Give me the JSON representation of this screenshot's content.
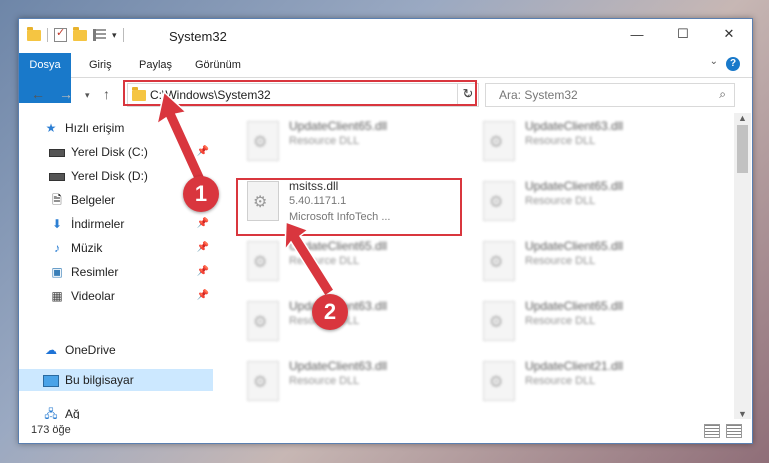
{
  "window": {
    "title": "System32"
  },
  "controls": {
    "minimize": "—",
    "maximize": "☐",
    "close": "✕"
  },
  "ribbon": {
    "tabs": [
      "Dosya",
      "Giriş",
      "Paylaş",
      "Görünüm"
    ],
    "help": "?"
  },
  "address": {
    "path": "C:\\Windows\\System32"
  },
  "search": {
    "placeholder": "Ara: System32"
  },
  "nav": {
    "items": [
      {
        "label": "Hızlı erişim",
        "icon": "star-icon"
      },
      {
        "label": "Yerel Disk (C:)",
        "icon": "disk-icon"
      },
      {
        "label": "Yerel Disk (D:)",
        "icon": "disk-icon"
      },
      {
        "label": "Belgeler",
        "icon": "documents-icon"
      },
      {
        "label": "İndirmeler",
        "icon": "download-icon"
      },
      {
        "label": "Müzik",
        "icon": "music-icon"
      },
      {
        "label": "Resimler",
        "icon": "pictures-icon"
      },
      {
        "label": "Videolar",
        "icon": "videos-icon"
      },
      {
        "label": "OneDrive",
        "icon": "cloud-icon"
      },
      {
        "label": "Bu bilgisayar",
        "icon": "computer-icon"
      },
      {
        "label": "Ağ",
        "icon": "network-icon"
      }
    ]
  },
  "files": {
    "highlighted": {
      "name": "msitss.dll",
      "version": "5.40.1171.1",
      "description": "Microsoft InfoTech ..."
    },
    "others": [
      {
        "name": "UpdateClient65.dll",
        "type": "Resource DLL"
      },
      {
        "name": "UpdateClient63.dll",
        "type": "Resource DLL"
      },
      {
        "name": "UpdateClient65.dll",
        "type": "Resource DLL"
      },
      {
        "name": "UpdateClient65.dll",
        "type": "Resource DLL"
      },
      {
        "name": "UpdateClient65.dll",
        "type": "Resource DLL"
      },
      {
        "name": "UpdateClient63.dll",
        "type": "Resource DLL"
      },
      {
        "name": "UpdateClient65.dll",
        "type": "Resource DLL"
      },
      {
        "name": "UpdateClient63.dll",
        "type": "Resource DLL"
      },
      {
        "name": "UpdateClient63.dll",
        "type": "Resource DLL"
      },
      {
        "name": "UpdateClient21.dll",
        "type": "Resource DLL"
      }
    ]
  },
  "status": {
    "count": "173 öğe"
  },
  "annotations": {
    "step1": "1",
    "step2": "2",
    "color": "#d9363e"
  }
}
